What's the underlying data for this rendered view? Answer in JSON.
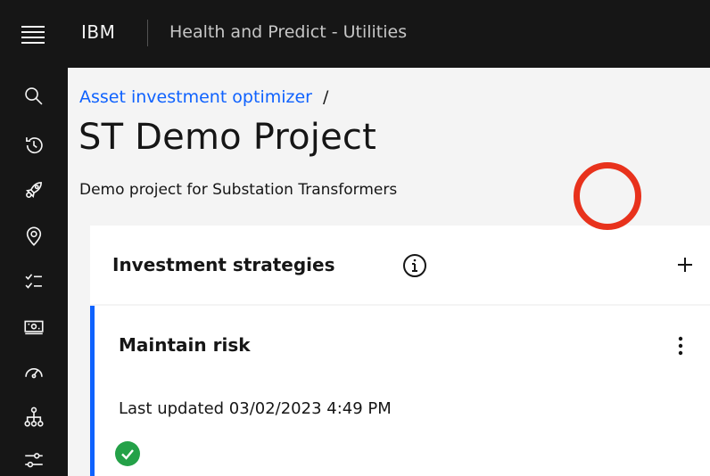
{
  "header": {
    "brand": "IBM",
    "app_title": "Health and Predict - Utilities"
  },
  "sidenav": {
    "items": [
      {
        "icon": "search-icon"
      },
      {
        "icon": "recent-history-icon"
      },
      {
        "icon": "rocket-icon"
      },
      {
        "icon": "location-icon"
      },
      {
        "icon": "checklist-icon"
      },
      {
        "icon": "money-icon"
      },
      {
        "icon": "dashboard-gauge-icon"
      },
      {
        "icon": "hierarchy-icon"
      },
      {
        "icon": "settings-adjust-icon"
      }
    ]
  },
  "breadcrumb": {
    "link": "Asset investment optimizer",
    "separator": "/"
  },
  "page": {
    "title": "ST Demo Project",
    "description": "Demo project for Substation Transformers"
  },
  "strategies_section": {
    "title": "Investment strategies",
    "info_icon": "information-icon",
    "add_icon": "add-icon",
    "highlight_color": "#e8321c"
  },
  "strategy": {
    "name": "Maintain risk",
    "last_updated": "Last updated 03/02/2023 4:49 PM",
    "status_icon": "checkmark-filled-icon",
    "status_color": "#24a148",
    "accent_color": "#0f62fe"
  }
}
